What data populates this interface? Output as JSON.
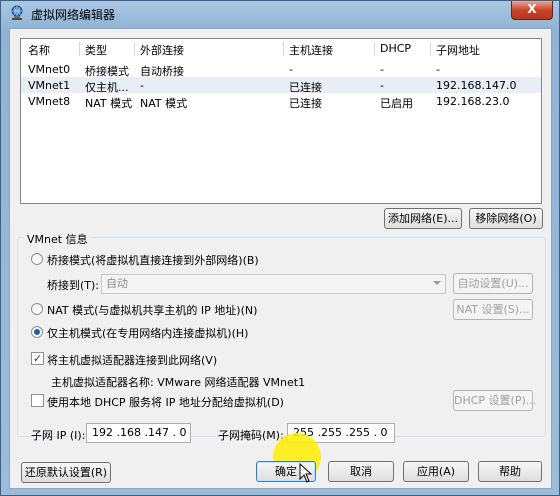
{
  "window": {
    "title": "虚拟网络编辑器",
    "close_label": "X"
  },
  "network_list": {
    "columns": [
      "名称",
      "类型",
      "外部连接",
      "主机连接",
      "DHCP",
      "子网地址"
    ],
    "rows": [
      {
        "name": "VMnet0",
        "type": "桥接模式",
        "external": "自动桥接",
        "host": "-",
        "dhcp": "-",
        "subnet": "-"
      },
      {
        "name": "VMnet1",
        "type": "仅主机...",
        "external": "-",
        "host": "已连接",
        "dhcp": "-",
        "subnet": "192.168.147.0"
      },
      {
        "name": "VMnet8",
        "type": "NAT 模式",
        "external": "NAT 模式",
        "host": "已连接",
        "dhcp": "已启用",
        "subnet": "192.168.23.0"
      }
    ],
    "selected_row": 1
  },
  "list_buttons": {
    "add_network": "添加网络(E)...",
    "remove_network": "移除网络(O)"
  },
  "vmnet_info": {
    "group_title": "VMnet 信息",
    "bridged_label": "桥接模式(将虚拟机直接连接到外部网络)(B)",
    "bridged_to_label": "桥接到(T):",
    "bridged_to_value": "自动",
    "auto_settings": "自动设置(U)...",
    "nat_label": "NAT 模式(与虚拟机共享主机的 IP 地址)(N)",
    "nat_settings": "NAT 设置(S)...",
    "hostonly_label": "仅主机模式(在专用网络内连接虚拟机)(H)",
    "selected_mode": "hostonly",
    "connect_adapter_label": "将主机虚拟适配器连接到此网络(V)",
    "connect_adapter_checked": true,
    "adapter_name_label": "主机虚拟适配器名称: VMware 网络适配器 VMnet1",
    "dhcp_label": "使用本地 DHCP 服务将 IP 地址分配给虚拟机(D)",
    "dhcp_checked": false,
    "dhcp_settings": "DHCP 设置(P)...",
    "subnet_ip_label": "子网 IP (I):",
    "subnet_ip_value": "192 .168 .147 . 0",
    "subnet_mask_label": "子网掩码(M):",
    "subnet_mask_value": "255 .255 .255 . 0"
  },
  "footer": {
    "restore_defaults": "还原默认设置(R)",
    "ok": "确定",
    "cancel": "取消",
    "apply": "应用(A)",
    "help": "帮助"
  },
  "colors": {
    "selection": "#e8eef6",
    "radio_dot": "#1a5ea8",
    "highlight": "#ffee00"
  }
}
